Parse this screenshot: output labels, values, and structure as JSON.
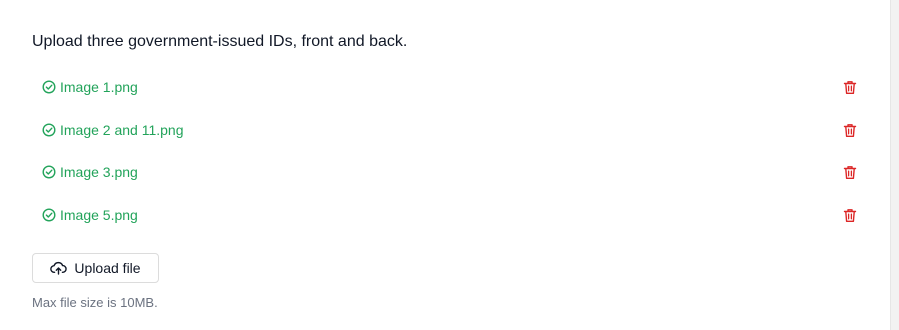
{
  "prompt": "Upload three government-issued IDs, front and back.",
  "files": [
    {
      "name": "Image 1.png",
      "status_icon": "check-circle-icon",
      "action_icon": "trash-icon"
    },
    {
      "name": "Image 2 and 11.png",
      "status_icon": "check-circle-icon",
      "action_icon": "trash-icon"
    },
    {
      "name": "Image 3.png",
      "status_icon": "check-circle-icon",
      "action_icon": "trash-icon"
    },
    {
      "name": "Image 5.png",
      "status_icon": "check-circle-icon",
      "action_icon": "trash-icon"
    }
  ],
  "upload": {
    "label": "Upload file",
    "icon": "cloud-upload-icon"
  },
  "hint": "Max file size is 10MB.",
  "colors": {
    "success": "#22a35a",
    "danger": "#dc2626",
    "text": "#111827",
    "muted": "#6b7280"
  }
}
